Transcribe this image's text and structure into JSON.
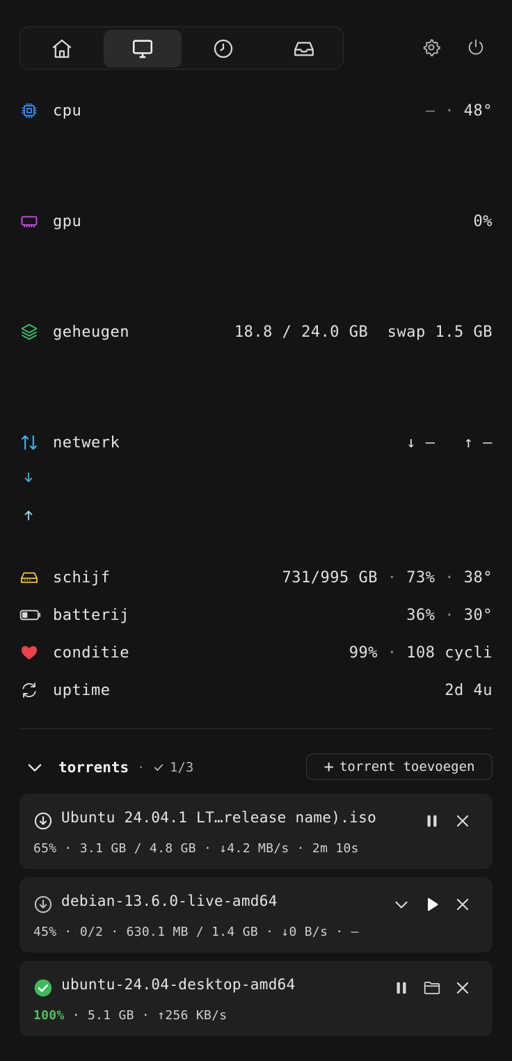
{
  "nav": {
    "tabs": [
      {
        "name": "home",
        "icon": "home-icon"
      },
      {
        "name": "monitor",
        "icon": "monitor-icon",
        "active": true
      },
      {
        "name": "history",
        "icon": "clock-icon"
      },
      {
        "name": "inbox",
        "icon": "inbox-icon"
      }
    ],
    "actions": [
      {
        "icon": "gear-icon"
      },
      {
        "icon": "power-icon"
      }
    ]
  },
  "metrics": {
    "cpu": {
      "label": "cpu",
      "usage": "—",
      "sep": "·",
      "temp": "48°",
      "color": "#2f8cf0"
    },
    "gpu": {
      "label": "gpu",
      "value": "0%",
      "color": "#c84ee6"
    },
    "memory": {
      "label": "geheugen",
      "used": "18.8 / 24.0 GB",
      "swap": "swap 1.5 GB",
      "color": "#35c26a"
    },
    "network": {
      "label": "netwerk",
      "down": "↓ —",
      "up": "↑ —",
      "color": "#3fb4e8"
    },
    "disk": {
      "label": "schijf",
      "value": "731/995 GB",
      "pct": "73%",
      "temp": "38°",
      "sep": "·",
      "color": "#f0c030"
    },
    "battery": {
      "label": "batterij",
      "pct": "36%",
      "temp": "30°",
      "sep": "·",
      "level": 0.36
    },
    "health": {
      "label": "conditie",
      "pct": "99%",
      "cycles": "108 cycli",
      "sep": "·",
      "color": "#f0404a"
    },
    "uptime": {
      "label": "uptime",
      "value": "2d 4u"
    }
  },
  "torrents": {
    "title": "torrents",
    "sep": "·",
    "count": "1/3",
    "add_label": "torrent toevoegen",
    "items": [
      {
        "name": "Ubuntu 24.04.1 LT…release name).iso",
        "status": "downloading",
        "meta": "65% · 3.1 GB / 4.8 GB · ↓4.2 MB/s · 2m 10s"
      },
      {
        "name": "debian-13.6.0-live-amd64",
        "status": "paused",
        "meta": "45% · 0/2 · 630.1 MB / 1.4 GB · ↓0 B/s · —"
      },
      {
        "name": "ubuntu-24.04-desktop-amd64",
        "status": "completed",
        "pct": "100%",
        "meta": " · 5.1 GB · ↑256 KB/s"
      }
    ]
  }
}
